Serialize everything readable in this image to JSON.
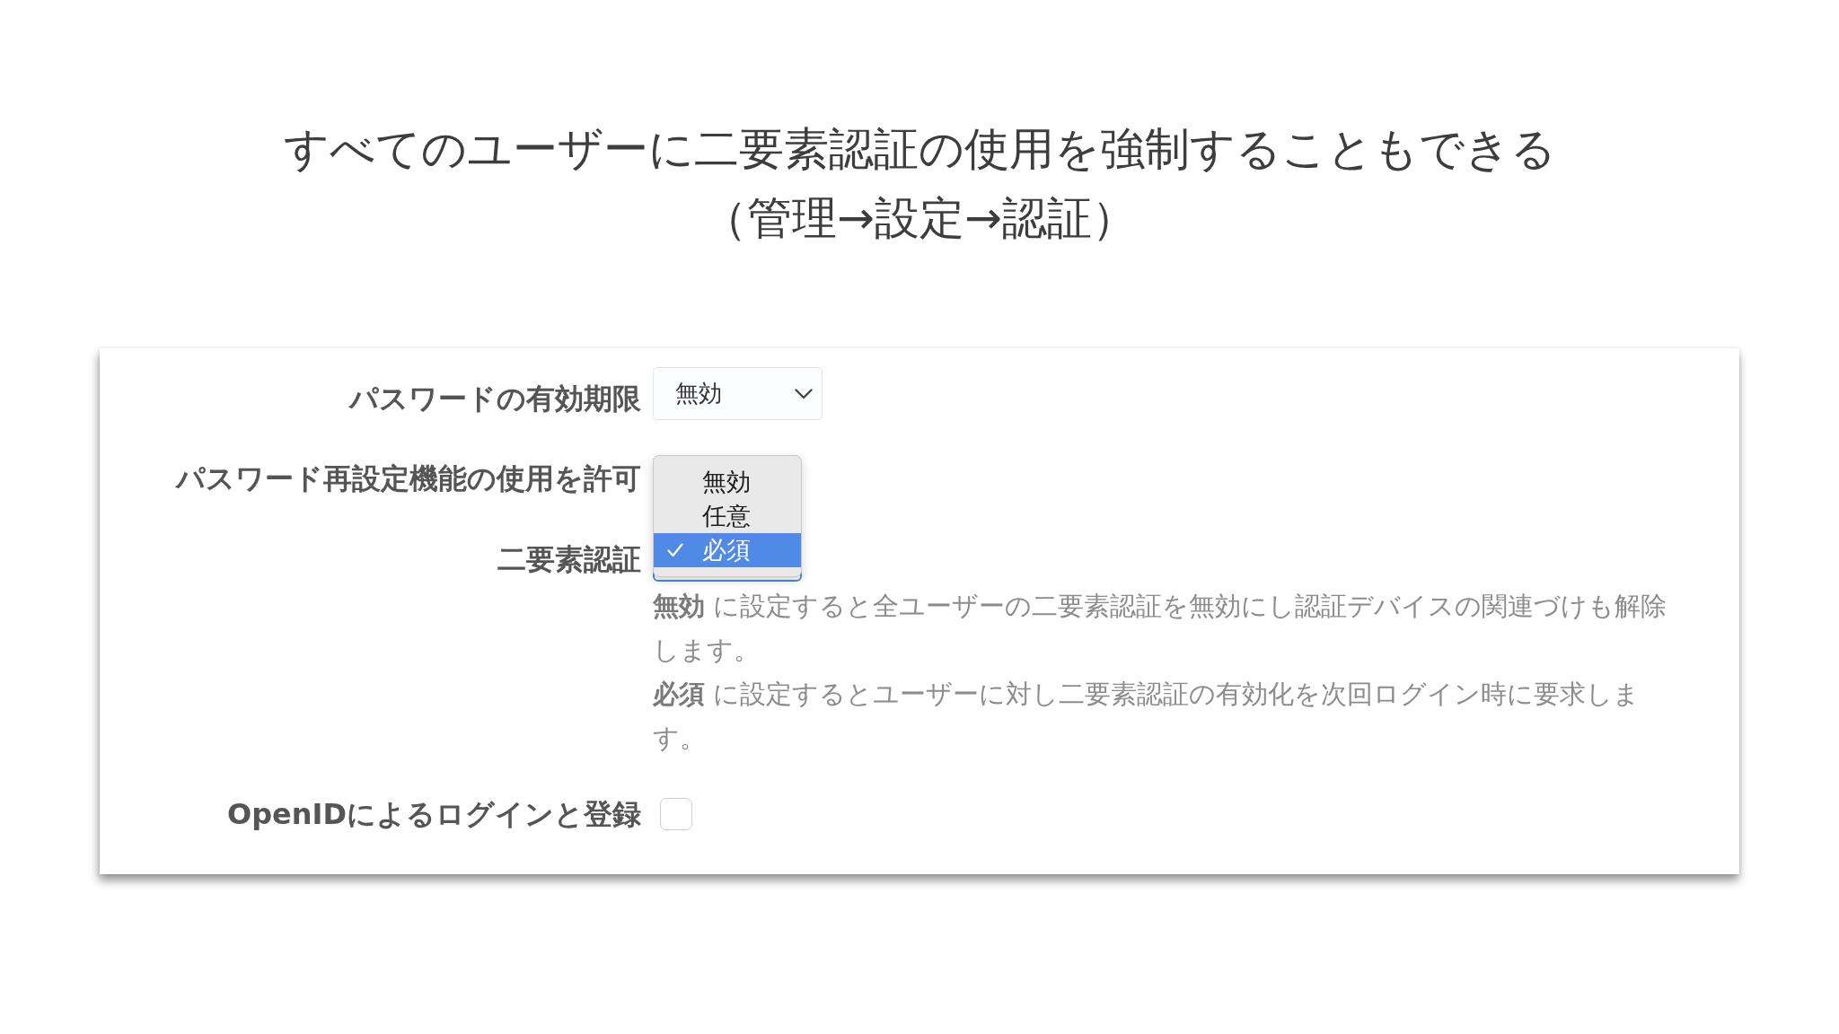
{
  "heading": {
    "lines": [
      "すべてのユーザーに二要素認証の使用を強制することもできる",
      "（管理→設定→認証）"
    ]
  },
  "settings_panel": {
    "rows": [
      {
        "kind": "select",
        "label": "パスワードの有効期限",
        "value": "無効"
      },
      {
        "kind": "covered",
        "label": "パスワード再設定機能の使用を許可"
      },
      {
        "kind": "select_open",
        "label": "二要素認証",
        "options": [
          {
            "label": "無効",
            "selected": false
          },
          {
            "label": "任意",
            "selected": false
          },
          {
            "label": "必須",
            "selected": true
          }
        ],
        "help": [
          "**無効** に設定すると全ユーザーの二要素認証を無効にし認証デバイスの関連づけも解除します。",
          "**必須** に設定するとユーザーに対し二要素認証の有効化を次回ログイン時に要求します。"
        ]
      },
      {
        "kind": "checkbox",
        "label": "OpenIDによるログインと登録",
        "checked": false
      }
    ]
  }
}
